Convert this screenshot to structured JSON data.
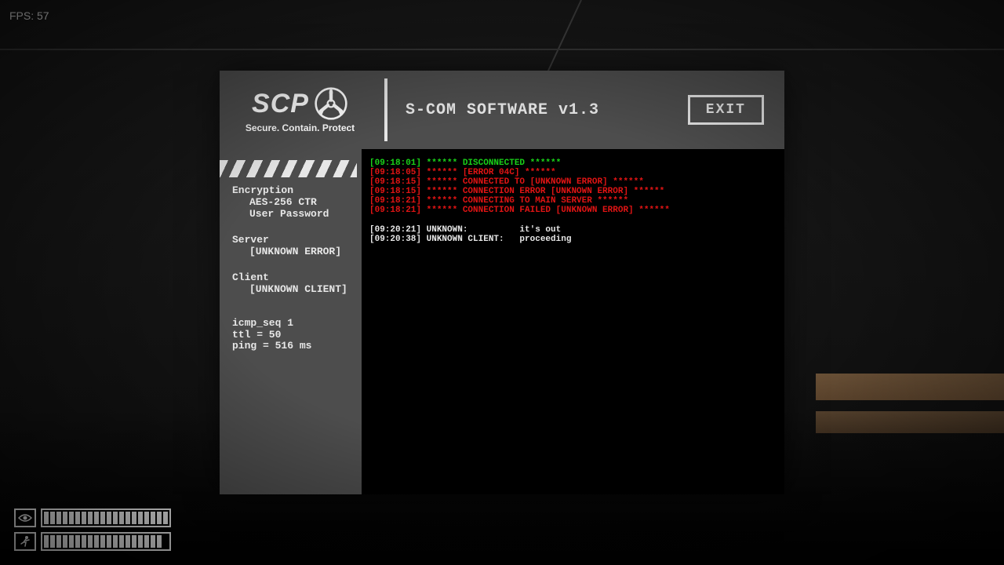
{
  "hud": {
    "fps_label": "FPS: 57",
    "blink_segments_total": 20,
    "blink_segments_filled": 20,
    "stamina_segments_total": 20,
    "stamina_segments_filled": 19
  },
  "panel": {
    "logo": {
      "title": "SCP",
      "tagline": "Secure. Contain. Protect"
    },
    "title": "S-COM SOFTWARE v1.3",
    "exit_label": "EXIT"
  },
  "sidebar": {
    "encryption": {
      "heading": "Encryption",
      "cipher": "AES-256 CTR",
      "auth": "User Password"
    },
    "server": {
      "heading": "Server",
      "value": "[UNKNOWN ERROR]"
    },
    "client": {
      "heading": "Client",
      "value": "[UNKNOWN CLIENT]"
    },
    "net": {
      "icmp": "icmp_seq 1",
      "ttl": "ttl = 50",
      "ping": "ping = 516 ms"
    }
  },
  "terminal": {
    "lines": [
      {
        "color": "green",
        "text": "[09:18:01] ****** DISCONNECTED ******"
      },
      {
        "color": "red",
        "text": "[09:18:05] ****** [ERROR 04C] ******"
      },
      {
        "color": "red",
        "text": "[09:18:15] ****** CONNECTED TO [UNKNOWN ERROR] ******"
      },
      {
        "color": "red",
        "text": "[09:18:15] ****** CONNECTION ERROR [UNKNOWN ERROR] ******"
      },
      {
        "color": "red",
        "text": "[09:18:21] ****** CONNECTING TO MAIN SERVER ******"
      },
      {
        "color": "red",
        "text": "[09:18:21] ****** CONNECTION FAILED [UNKNOWN ERROR] ******"
      }
    ],
    "chat": [
      {
        "time": "[09:20:21]",
        "who": "UNKNOWN:",
        "msg": "it's out"
      },
      {
        "time": "[09:20:38]",
        "who": "UNKNOWN CLIENT:",
        "msg": "proceeding"
      }
    ]
  }
}
